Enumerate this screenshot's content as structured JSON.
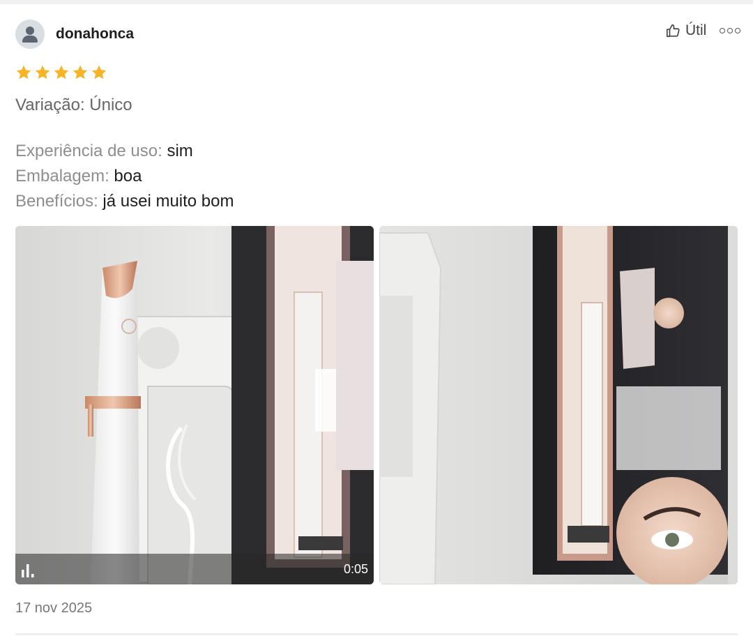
{
  "review": {
    "username": "donahonca",
    "rating": 5,
    "rating_max": 5,
    "star_color": "#f7b426",
    "helpful_label": "Útil",
    "variation": "Variação: Único",
    "attributes": [
      {
        "label": "Experiência de uso:",
        "value": "sim"
      },
      {
        "label": "Embalagem:",
        "value": "boa"
      },
      {
        "label": "Benefícios:",
        "value": "já usei muito bom"
      }
    ],
    "media": [
      {
        "kind": "video",
        "duration": "0:05",
        "description": "Foto do produto depilador facial branco com detalhes dourados"
      },
      {
        "kind": "image",
        "description": "Embalagem do produto"
      }
    ],
    "date": "17 nov 2025"
  },
  "icons": {
    "avatar": "user-avatar-icon",
    "helpful": "thumbs-up-icon",
    "more": "more-options-icon",
    "volume": "audio-bars-icon"
  }
}
